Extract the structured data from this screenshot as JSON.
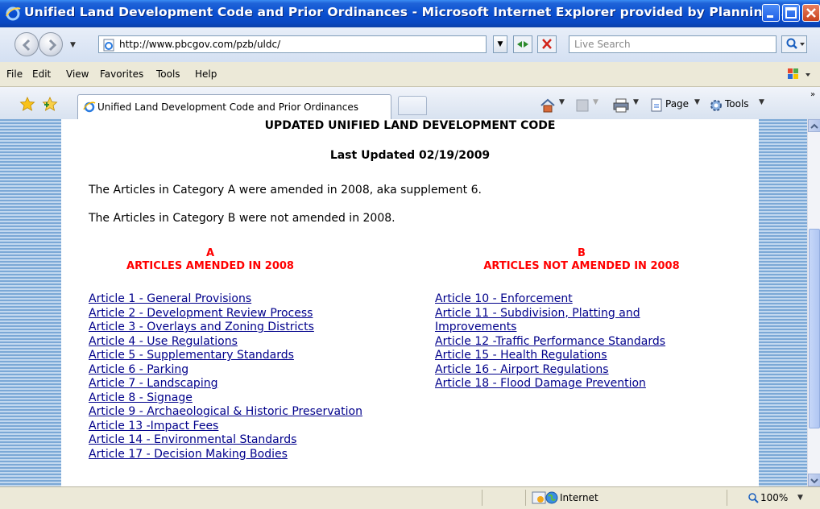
{
  "window": {
    "title": "Unified Land Development Code and Prior Ordinances - Microsoft Internet Explorer provided by Planning, ..."
  },
  "address_bar": {
    "url": "http://www.pbcgov.com/pzb/uldc/",
    "search_placeholder": "Live Search"
  },
  "menu": {
    "items": [
      {
        "label": "File"
      },
      {
        "label": "Edit"
      },
      {
        "label": "View"
      },
      {
        "label": "Favorites"
      },
      {
        "label": "Tools"
      },
      {
        "label": "Help"
      }
    ]
  },
  "tabs": {
    "active_label": "Unified Land Development Code and Prior Ordinances"
  },
  "command_bar": {
    "page_label": "Page",
    "tools_label": "Tools"
  },
  "document": {
    "title": "UPDATED UNIFIED LAND DEVELOPMENT CODE",
    "last_updated": "Last Updated 02/19/2009",
    "paragraph_a": "The Articles in Category A were amended in 2008, aka supplement 6.",
    "paragraph_b": "The Articles in Category B were not amended in 2008.",
    "column_a": {
      "letter": "A",
      "heading": "ARTICLES AMENDED IN 2008",
      "links": [
        "Article 1 - General Provisions",
        "Article 2 - Development Review Process",
        "Article 3 - Overlays and Zoning Districts",
        "Article 4 - Use Regulations",
        "Article 5 - Supplementary Standards",
        "Article 6 - Parking",
        "Article 7 - Landscaping",
        "Article 8 - Signage",
        "Article 9 - Archaeological & Historic Preservation",
        "Article 13 -Impact Fees",
        "Article 14 - Environmental Standards",
        "Article 17 - Decision Making Bodies"
      ]
    },
    "column_b": {
      "letter": "B",
      "heading": "ARTICLES NOT AMENDED IN 2008",
      "links": [
        "Article 10 - Enforcement",
        "Article 11 - Subdivision, Platting and Improvements",
        "Article 12 -Traffic Performance Standards",
        "Article 15 - Health Regulations",
        "Article 16 - Airport Regulations",
        "Article 18 - Flood Damage Prevention"
      ]
    }
  },
  "status_bar": {
    "zone": "Internet",
    "zoom": "100%"
  },
  "colors": {
    "title_bar": "#0a4fd0",
    "heading_red": "#ff0000",
    "link": "#00008b",
    "stripe_dark": "#7ba8d6",
    "stripe_light": "#c2d8ef"
  }
}
